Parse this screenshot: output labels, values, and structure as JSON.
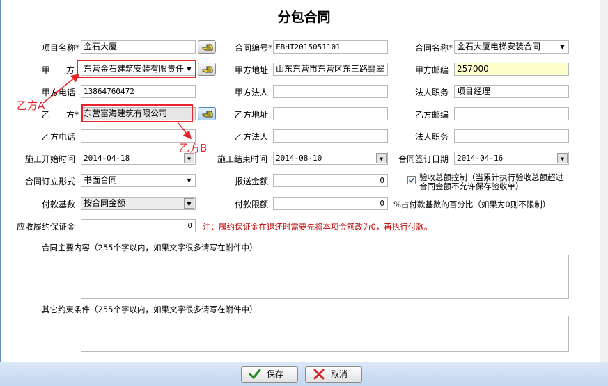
{
  "title": "分包合同",
  "row1": {
    "project_name_label": "项目名称*",
    "project_name_value": "金石大厦",
    "contract_no_label": "合同编号*",
    "contract_no_value": "FBHT2015051101",
    "contract_name_label": "合同名称*",
    "contract_name_value": "金石大厦电梯安装合同"
  },
  "row2": {
    "party_a_label_1": "甲",
    "party_a_label_2": "方",
    "party_a_value": "东营金石建筑安装有限责任",
    "party_a_addr_label": "甲方地址",
    "party_a_addr_value": "山东东营市东营区东三路翡翠",
    "party_a_zip_label": "甲方邮编",
    "party_a_zip_value": "257000"
  },
  "row3": {
    "party_a_phone_label": "甲方电话",
    "party_a_phone_value": "13864760472",
    "party_a_legal_label": "甲方法人",
    "party_a_legal_value": "",
    "legal_title_label": "法人职务",
    "legal_title_value": "项目经理"
  },
  "row4": {
    "party_b_label_1": "乙",
    "party_b_label_2": "方*",
    "party_b_value": "东营富海建筑有限公司",
    "party_b_addr_label": "乙方地址",
    "party_b_addr_value": "",
    "party_b_zip_label": "乙方邮编",
    "party_b_zip_value": ""
  },
  "row5": {
    "party_b_phone_label": "乙方电话",
    "party_b_phone_value": "",
    "party_b_legal_label": "乙方法人",
    "party_b_legal_value": "",
    "legal_title_label": "法人职务",
    "legal_title_value": ""
  },
  "row6": {
    "start_label": "施工开始时间",
    "start_value": "2014-04-18",
    "end_label": "施工结束时间",
    "end_value": "2014-08-10",
    "sign_label": "合同签订日期",
    "sign_value": "2014-04-16"
  },
  "row7": {
    "form_label": "合同订立形式",
    "form_value": "书面合同",
    "report_amount_label": "报送金额",
    "report_amount_value": "0",
    "acceptance_checked": true,
    "acceptance_label_1": "验收总额控制（当累计执行验收总额超过",
    "acceptance_label_2": "合同金额不允许保存验收单）"
  },
  "row8": {
    "pay_base_label": "付款基数",
    "pay_base_value": "按合同金额",
    "pay_limit_label": "付款限额",
    "pay_limit_value": "0",
    "pay_limit_note": "%占付款基数的百分比（如果为0则不限制）"
  },
  "row9": {
    "deposit_label": "应收履约保证金",
    "deposit_value": "0",
    "deposit_note": "注：履约保证金在退还时需要先将本项金额改为0，再执行付款。"
  },
  "content": {
    "main_label": "合同主要内容（255个字以内，如果文字很多请写在附件中）",
    "main_value": "",
    "other_label": "其它约束条件（255个字以内，如果文字很多请写在附件中）",
    "other_value": ""
  },
  "annotations": {
    "a": "乙方A",
    "b": "乙方B",
    "color": "#e8232a"
  },
  "footer": {
    "save_label": "保存",
    "cancel_label": "取消"
  },
  "icons": {
    "picker": "hand-pointer-icon",
    "save": "checkmark-icon",
    "cancel": "x-icon",
    "dropdown": "chevron-down-icon"
  }
}
